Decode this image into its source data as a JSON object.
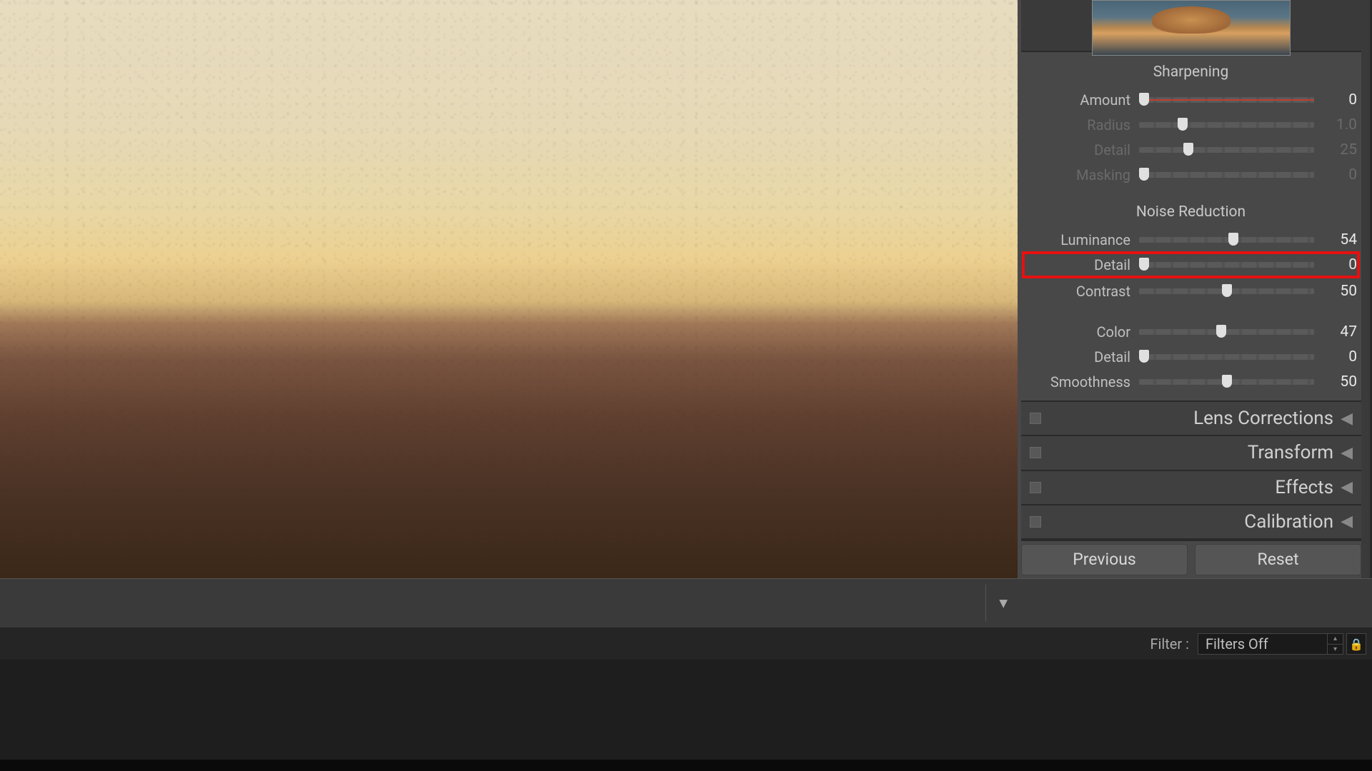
{
  "sharpening": {
    "title": "Sharpening",
    "amount": {
      "label": "Amount",
      "value": "0",
      "pos": 3
    },
    "radius": {
      "label": "Radius",
      "value": "1.0",
      "pos": 25
    },
    "detail": {
      "label": "Detail",
      "value": "25",
      "pos": 28
    },
    "masking": {
      "label": "Masking",
      "value": "0",
      "pos": 3
    }
  },
  "noise_reduction": {
    "title": "Noise Reduction",
    "luminance": {
      "label": "Luminance",
      "value": "54",
      "pos": 54
    },
    "detail": {
      "label": "Detail",
      "value": "0",
      "pos": 3
    },
    "contrast": {
      "label": "Contrast",
      "value": "50",
      "pos": 50
    },
    "color": {
      "label": "Color",
      "value": "47",
      "pos": 47
    },
    "color_detail": {
      "label": "Detail",
      "value": "0",
      "pos": 3
    },
    "smoothness": {
      "label": "Smoothness",
      "value": "50",
      "pos": 50
    }
  },
  "panels": {
    "lens_corrections": "Lens Corrections",
    "transform": "Transform",
    "effects": "Effects",
    "calibration": "Calibration"
  },
  "buttons": {
    "previous": "Previous",
    "reset": "Reset"
  },
  "filter": {
    "label": "Filter :",
    "value": "Filters Off"
  }
}
